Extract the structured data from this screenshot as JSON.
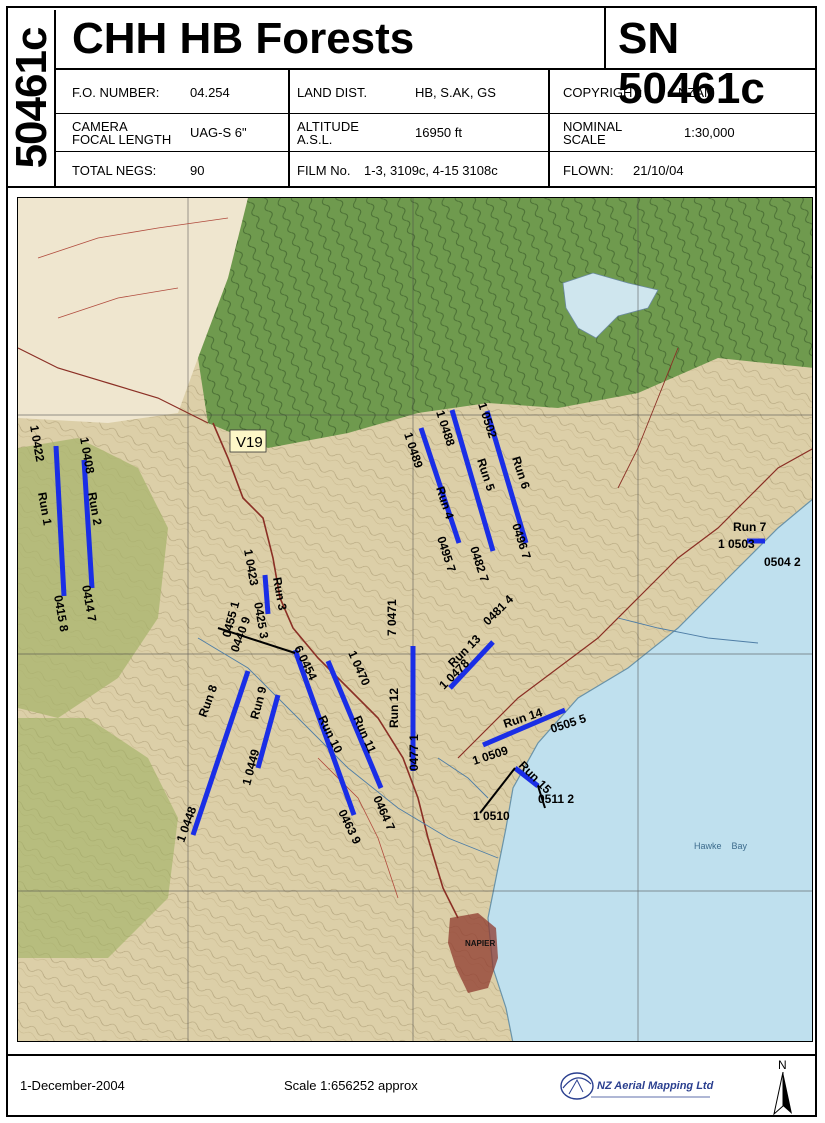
{
  "header": {
    "side_code": "50461c",
    "title": "CHH HB Forests",
    "sn": "SN 50461c"
  },
  "info": {
    "fo_label": "F.O. NUMBER:",
    "fo_value": "04.254",
    "land_label": "LAND DIST.",
    "land_value": "HB, S.AK, GS",
    "copyright_label": "COPYRIGHT:",
    "copyright_value": "NZAM",
    "camera_label_1": "CAMERA",
    "camera_label_2": "FOCAL LENGTH",
    "camera_value": "UAG-S 6\"",
    "altitude_label_1": "ALTITUDE",
    "altitude_label_2": "A.S.L.",
    "altitude_value": "16950 ft",
    "nominal_label_1": "NOMINAL",
    "nominal_label_2": "SCALE",
    "nominal_value": "1:30,000",
    "negs_label": "TOTAL NEGS:",
    "negs_value": "90",
    "film_label": "FILM No.",
    "film_value": "1-3, 3109c, 4-15 3108c",
    "flown_label": "FLOWN:",
    "flown_value": "21/10/04"
  },
  "map": {
    "sheet_label": "V19",
    "place_napier": "NAPIER",
    "place_hawke_bay": "Hawke    Bay",
    "colors": {
      "flight_line": "#1a2ee6",
      "sea": "#bfe0ee",
      "land": "#d9cba4",
      "forest": "#6f9a4e"
    },
    "runs": [
      {
        "name": "Run 1",
        "start_neg": "0422",
        "start_idx": "1",
        "end_neg": "0415",
        "end_idx": "8"
      },
      {
        "name": "Run 2",
        "start_neg": "0408",
        "start_idx": "1",
        "end_neg": "0414",
        "end_idx": "7"
      },
      {
        "name": "Run 3",
        "start_neg": "0423",
        "start_idx": "1",
        "end_neg": "0425",
        "end_idx": "3"
      },
      {
        "name": "Run 4",
        "start_neg": "0489",
        "start_idx": "1",
        "end_neg": "0495",
        "end_idx": "7"
      },
      {
        "name": "Run 5",
        "start_neg": "0488",
        "start_idx": "1",
        "end_neg": "0482",
        "end_idx": "7"
      },
      {
        "name": "Run 6",
        "start_neg": "0502",
        "start_idx": "1",
        "end_neg": "0496",
        "end_idx": "7"
      },
      {
        "name": "Run 7",
        "start_neg": "0503",
        "start_idx": "1",
        "end_neg": "0504",
        "end_idx": "2"
      },
      {
        "name": "Run 8",
        "start_neg": "0448",
        "start_idx": "1",
        "end_neg": "0440",
        "end_idx": "9"
      },
      {
        "name": "Run 9",
        "start_neg": "0449",
        "start_idx": "1",
        "end_neg": "0455",
        "end_idx": "1"
      },
      {
        "name": "Run 10",
        "start_neg": "0454",
        "start_idx": "6",
        "end_neg": "0463",
        "end_idx": "9"
      },
      {
        "name": "Run 11",
        "start_neg": "0470",
        "start_idx": "1",
        "end_neg": "0464",
        "end_idx": "7"
      },
      {
        "name": "Run 12",
        "start_neg": "0471",
        "start_idx": "7",
        "end_neg": "0477",
        "end_idx": "1"
      },
      {
        "name": "Run 13",
        "start_neg": "0478",
        "start_idx": "1",
        "end_neg": "0481",
        "end_idx": "4"
      },
      {
        "name": "Run 14",
        "start_neg": "0509",
        "start_idx": "1",
        "end_neg": "0505",
        "end_idx": "5"
      },
      {
        "name": "Run 15",
        "start_neg": "0510",
        "start_idx": "1",
        "end_neg": "0511",
        "end_idx": "2"
      }
    ]
  },
  "footer": {
    "date": "1-December-2004",
    "scale": "Scale  1:656252 approx",
    "logo_text": "NZ Aerial Mapping Ltd",
    "north": "N"
  }
}
